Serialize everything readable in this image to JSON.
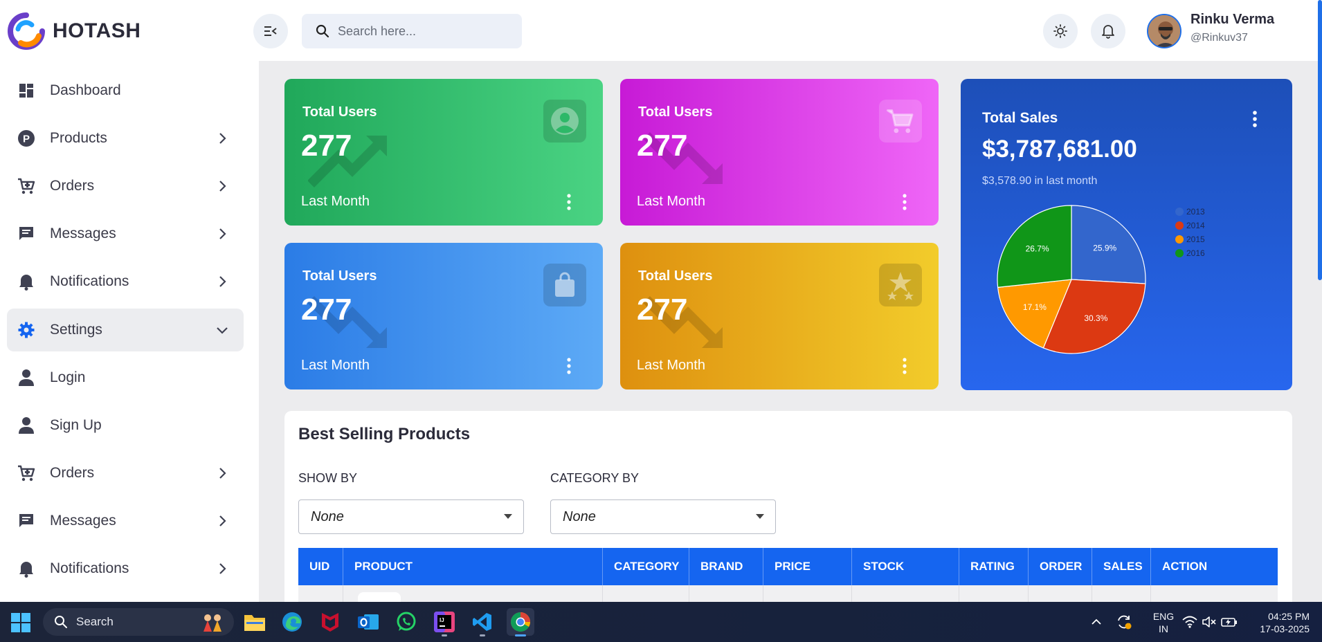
{
  "app": {
    "brand": "HOTASH"
  },
  "search": {
    "placeholder": "Search here..."
  },
  "user": {
    "name": "Rinku Verma",
    "handle": "@Rinkuv37"
  },
  "sidebar": {
    "items": [
      {
        "label": "Dashboard",
        "icon": "dashboard-icon",
        "chevron": "none"
      },
      {
        "label": "Products",
        "icon": "product-p-icon",
        "chevron": "right"
      },
      {
        "label": "Orders",
        "icon": "cart-icon",
        "chevron": "right"
      },
      {
        "label": "Messages",
        "icon": "message-icon",
        "chevron": "right"
      },
      {
        "label": "Notifications",
        "icon": "bell-icon",
        "chevron": "right"
      },
      {
        "label": "Settings",
        "icon": "gear-icon",
        "chevron": "down",
        "active": true
      },
      {
        "label": "Login",
        "icon": "user-icon",
        "chevron": "none"
      },
      {
        "label": "Sign Up",
        "icon": "user-icon",
        "chevron": "none"
      },
      {
        "label": "Orders",
        "icon": "cart-icon",
        "chevron": "right"
      },
      {
        "label": "Messages",
        "icon": "message-icon",
        "chevron": "right"
      },
      {
        "label": "Notifications",
        "icon": "bell-icon",
        "chevron": "right"
      }
    ]
  },
  "stat_cards": [
    {
      "title": "Total Users",
      "value": "277",
      "subtitle": "Last Month",
      "icon": "user-circle-icon",
      "trend": "up",
      "color_from": "#20a85a",
      "color_to": "#4ad383"
    },
    {
      "title": "Total Users",
      "value": "277",
      "subtitle": "Last Month",
      "icon": "cart-icon",
      "trend": "down",
      "color_from": "#c71ad6",
      "color_to": "#ef66f7"
    },
    {
      "title": "Total Users",
      "value": "277",
      "subtitle": "Last Month",
      "icon": "shopping-bag-icon",
      "trend": "down",
      "color_from": "#2b7ce6",
      "color_to": "#5daaf6"
    },
    {
      "title": "Total Users",
      "value": "277",
      "subtitle": "Last Month",
      "icon": "stars-icon",
      "trend": "down",
      "color_from": "#de900f",
      "color_to": "#f2cc2b"
    }
  ],
  "total_sales": {
    "title": "Total Sales",
    "value": "$3,787,681.00",
    "subtitle": "$3,578.90 in last month"
  },
  "chart_data": {
    "type": "pie",
    "labels": [
      "2013",
      "2014",
      "2015",
      "2016"
    ],
    "values": [
      25.9,
      30.3,
      17.1,
      26.7
    ],
    "value_labels": [
      "25.9%",
      "30.3%",
      "17.1%",
      "26.7%"
    ],
    "colors": [
      "#3366cc",
      "#dc3912",
      "#ff9900",
      "#109618"
    ],
    "legend": "right",
    "start_angle_deg": 0
  },
  "products": {
    "title": "Best Selling Products",
    "show_by": {
      "label": "SHOW BY",
      "value": "None"
    },
    "category_by": {
      "label": "CATEGORY BY",
      "value": "None"
    },
    "columns": [
      "UID",
      "PRODUCT",
      "CATEGORY",
      "BRAND",
      "PRICE",
      "STOCK",
      "RATING",
      "ORDER",
      "SALES",
      "ACTION"
    ]
  },
  "taskbar": {
    "search_label": "Search",
    "apps": [
      "file-explorer-icon",
      "edge-icon",
      "mcafee-icon",
      "outlook-icon",
      "whatsapp-icon",
      "intellij-icon",
      "vscode-icon",
      "chrome-icon"
    ],
    "lang_line1": "ENG",
    "lang_line2": "IN",
    "time": "04:25 PM",
    "date": "17-03-2025"
  }
}
